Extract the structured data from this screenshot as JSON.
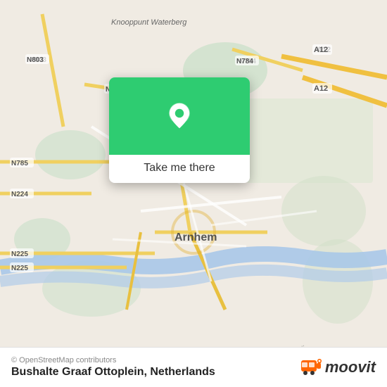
{
  "map": {
    "center_city": "Arnhem",
    "country": "Netherlands",
    "background_color": "#f0ebe3"
  },
  "popup": {
    "green_color": "#2ecc71",
    "button_label": "Take me there"
  },
  "bottom_bar": {
    "copyright": "© OpenStreetMap contributors",
    "location_name": "Bushalte Graaf Ottoplein, Netherlands"
  },
  "moovit": {
    "logo_text": "moovit"
  }
}
